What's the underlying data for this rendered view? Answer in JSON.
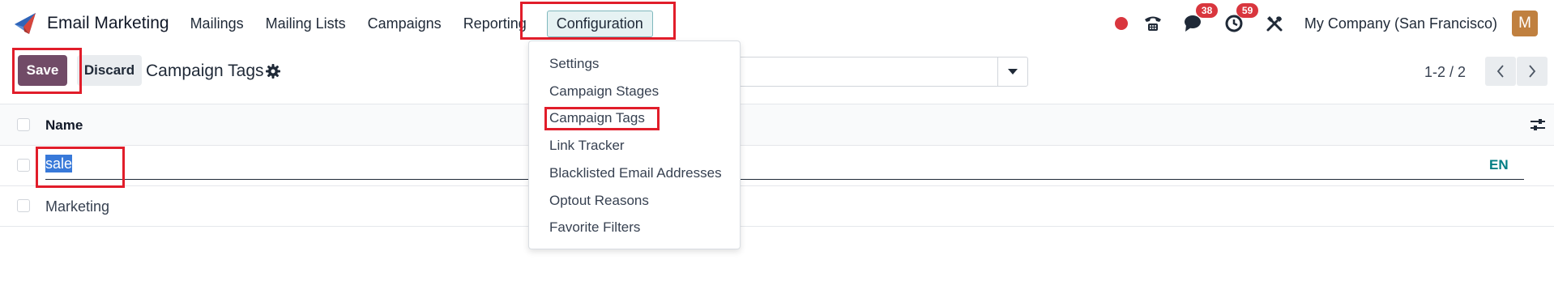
{
  "app": {
    "title": "Email Marketing",
    "logo_icon": "paper-plane-icon",
    "accent_color": "#714b67"
  },
  "menu": {
    "items": [
      {
        "label": "Mailings"
      },
      {
        "label": "Mailing Lists"
      },
      {
        "label": "Campaigns"
      },
      {
        "label": "Reporting"
      },
      {
        "label": "Configuration",
        "active": true
      }
    ]
  },
  "systray": {
    "recording_dot_color": "#d9363e",
    "phone_icon": "phone-icon",
    "messages_badge": "38",
    "activities_badge": "59",
    "debug_icon": "tools-icon",
    "company": "My Company (San Francisco)",
    "avatar_initial": "M",
    "avatar_color": "#c0803f"
  },
  "control": {
    "save_label": "Save",
    "discard_label": "Discard",
    "page_title": "Campaign Tags",
    "pager_value": "1-2 / 2"
  },
  "list": {
    "header": {
      "name": "Name"
    },
    "rows": [
      {
        "name": "sale",
        "editing": true,
        "lang_label": "EN"
      },
      {
        "name": "Marketing"
      }
    ]
  },
  "dropdown": {
    "items": [
      {
        "label": "Settings"
      },
      {
        "label": "Campaign Stages"
      },
      {
        "label": "Campaign Tags",
        "highlighted": true
      },
      {
        "label": "Link Tracker"
      },
      {
        "label": "Blacklisted Email Addresses"
      },
      {
        "label": "Optout Reasons"
      },
      {
        "label": "Favorite Filters"
      }
    ]
  },
  "annotation_color": "#e11d2a"
}
